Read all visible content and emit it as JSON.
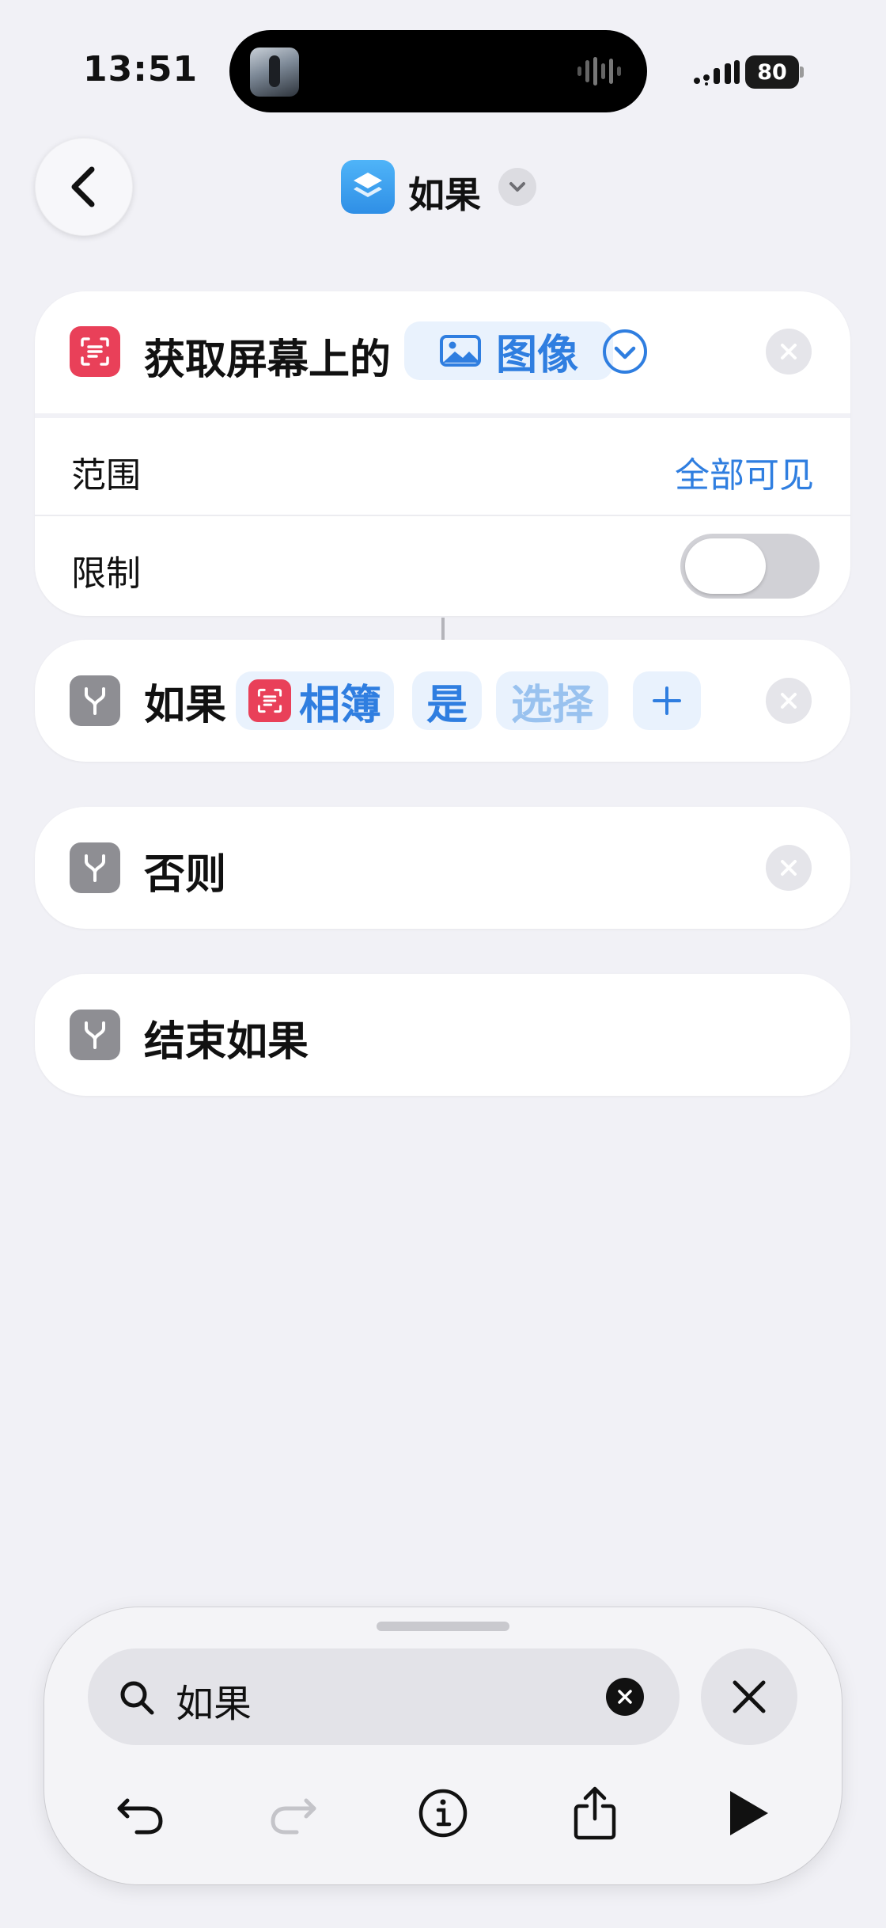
{
  "status_bar": {
    "time": "13:51",
    "battery": "80"
  },
  "nav": {
    "title": "如果"
  },
  "get_screen_action": {
    "prefix": "获取屏幕上的",
    "param": "图像",
    "rows": [
      {
        "label": "范围",
        "value": "全部可见"
      },
      {
        "label": "限制",
        "toggle_on": false
      }
    ]
  },
  "if_action": {
    "label": "如果",
    "variable": "相簿",
    "operator": "是",
    "value_placeholder": "选择",
    "add": "+"
  },
  "otherwise_action": {
    "label": "否则"
  },
  "end_if_action": {
    "label": "结束如果"
  },
  "search": {
    "query": "如果"
  },
  "colors": {
    "accent": "#2f7ee0",
    "red_icon": "#e94059",
    "gray_icon": "#8e8e93",
    "background": "#f1f1f6"
  },
  "icons": [
    "back-chevron",
    "shortcuts-layers",
    "chevron-down",
    "text-scan",
    "photo",
    "circle-chevron-down",
    "close",
    "branch-y",
    "magnifier",
    "undo",
    "redo",
    "info",
    "share",
    "play"
  ]
}
